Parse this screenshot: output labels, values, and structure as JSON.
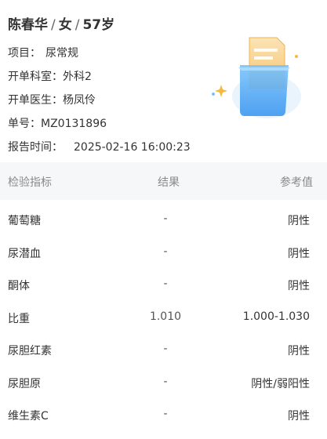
{
  "patient": {
    "name": "陈春华",
    "gender": "女",
    "age": "57岁",
    "separator": "/"
  },
  "info": [
    {
      "label": "项目：",
      "value": "尿常规"
    },
    {
      "label": "开单科室：",
      "value": "外科2"
    },
    {
      "label": "开单医生：",
      "value": "杨凤伶"
    },
    {
      "label": "单号：",
      "value": "MZ0131896"
    },
    {
      "label": "报告时间：",
      "value": "2025-02-16 16:00:23"
    }
  ],
  "illustration_icon": "report-document-icon",
  "table": {
    "headers": {
      "indicator": "检验指标",
      "result": "结果",
      "reference": "参考值"
    },
    "rows": [
      {
        "name": "葡萄糖",
        "result": "-",
        "reference": "阴性"
      },
      {
        "name": "尿潜血",
        "result": "-",
        "reference": "阴性"
      },
      {
        "name": "酮体",
        "result": "-",
        "reference": "阴性"
      },
      {
        "name": "比重",
        "result": "1.010",
        "reference": "1.000-1.030"
      },
      {
        "name": "尿胆红素",
        "result": "-",
        "reference": "阴性"
      },
      {
        "name": "尿胆原",
        "result": "-",
        "reference": "阴性/弱阳性"
      },
      {
        "name": "维生素C",
        "result": "-",
        "reference": "阴性"
      }
    ]
  },
  "colors": {
    "header_bg": "#f6f7f9",
    "folder_blue": "#4aa3f5",
    "paper_orange": "#f7c36b",
    "sparkle": "#f5b942"
  }
}
